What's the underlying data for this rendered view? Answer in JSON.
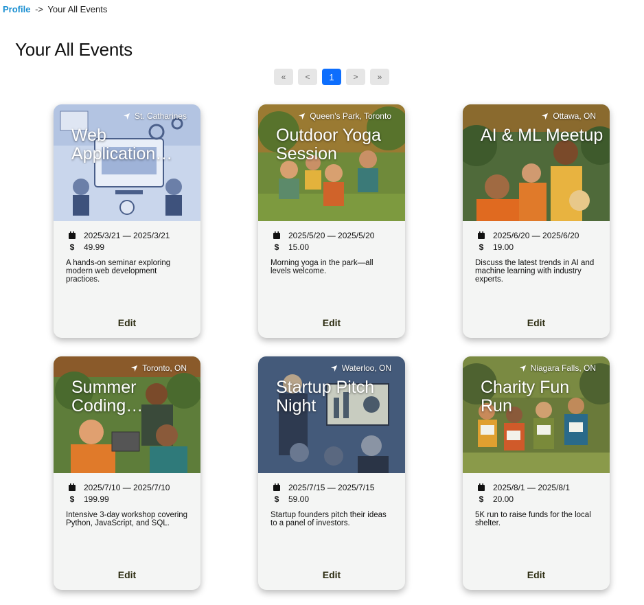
{
  "breadcrumb": {
    "profile_label": "Profile",
    "separator": "->",
    "current_label": "Your All Events"
  },
  "page_title": "Your All Events",
  "pagination": {
    "first": "«",
    "prev": "<",
    "current": "1",
    "next": ">",
    "last": "»"
  },
  "icons": {
    "location": "location-arrow-icon",
    "date": "calendar-icon",
    "price": "dollar-icon"
  },
  "events": [
    {
      "title": "Web Application…",
      "location": "St. Catharines",
      "dates": "2025/3/21 — 2025/3/21",
      "price": "49.99",
      "description": "A hands-on seminar exploring modern web development practices.",
      "edit_label": "Edit"
    },
    {
      "title": "Outdoor Yoga Session",
      "location": "Queen's Park, Toronto",
      "dates": "2025/5/20 — 2025/5/20",
      "price": "15.00",
      "description": "Morning yoga in the park—all levels welcome.",
      "edit_label": "Edit"
    },
    {
      "title": "AI & ML Meetup",
      "location": "Ottawa, ON",
      "dates": "2025/6/20 — 2025/6/20",
      "price": "19.00",
      "description": "Discuss the latest trends in AI and machine learning with industry experts.",
      "edit_label": "Edit"
    },
    {
      "title": "Summer Coding…",
      "location": "Toronto, ON",
      "dates": "2025/7/10 — 2025/7/10",
      "price": "199.99",
      "description": "Intensive 3-day workshop covering Python, JavaScript, and SQL.",
      "edit_label": "Edit"
    },
    {
      "title": "Startup Pitch Night",
      "location": "Waterloo, ON",
      "dates": "2025/7/15 — 2025/7/15",
      "price": "59.00",
      "description": "Startup founders pitch their ideas to a panel of investors.",
      "edit_label": "Edit"
    },
    {
      "title": "Charity Fun Run",
      "location": "Niagara Falls, ON",
      "dates": "2025/8/1 — 2025/8/1",
      "price": "20.00",
      "description": "5K run to raise funds for the local shelter.",
      "edit_label": "Edit"
    }
  ]
}
